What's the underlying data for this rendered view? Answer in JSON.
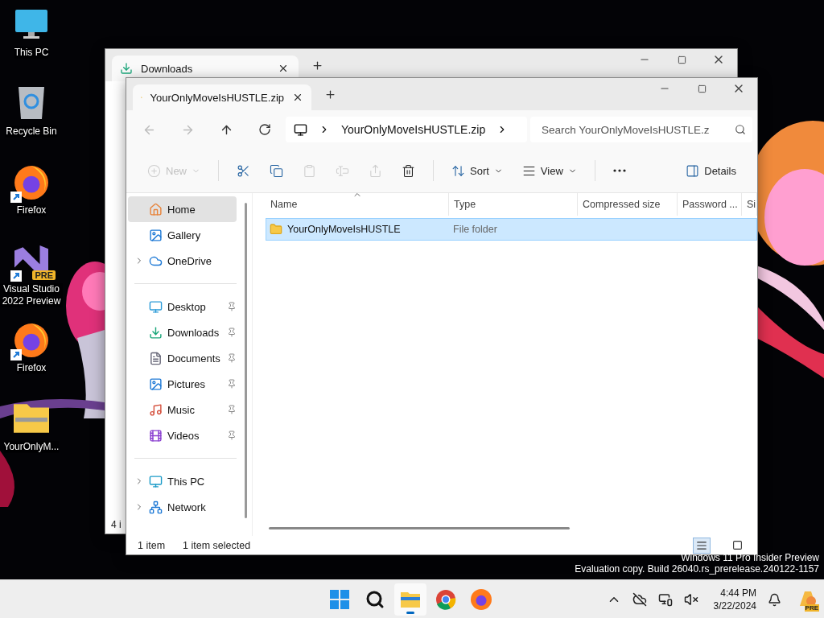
{
  "desktop_icons": [
    {
      "label": "This PC",
      "kind": "pc",
      "shortcut": false
    },
    {
      "label": "Recycle Bin",
      "kind": "bin",
      "shortcut": false
    },
    {
      "label": "Firefox",
      "kind": "firefox",
      "shortcut": true
    },
    {
      "label": "Visual Studio 2022 Preview",
      "kind": "vs",
      "shortcut": true,
      "badge": "PRE"
    },
    {
      "label": "Firefox",
      "kind": "firefox",
      "shortcut": true
    },
    {
      "label": "YourOnlyM...",
      "kind": "zip",
      "shortcut": false
    }
  ],
  "back_window": {
    "tab": "Downloads",
    "status": "4 i"
  },
  "window": {
    "tab": "YourOnlyMoveIsHUSTLE.zip",
    "breadcrumb": [
      "YourOnlyMoveIsHUSTLE.zip"
    ],
    "search": {
      "placeholder": "Search YourOnlyMoveIsHUSTLE.z"
    },
    "toolbar": [
      {
        "kind": "new",
        "label": "New",
        "disabled": true
      },
      {
        "kind": "cut",
        "disabled": false
      },
      {
        "kind": "copy",
        "disabled": false
      },
      {
        "kind": "paste",
        "disabled": true
      },
      {
        "kind": "rename",
        "disabled": true
      },
      {
        "kind": "share",
        "disabled": true
      },
      {
        "kind": "delete",
        "disabled": false
      },
      {
        "kind": "sort",
        "label": "Sort",
        "disabled": false
      },
      {
        "kind": "view",
        "label": "View",
        "disabled": false
      },
      {
        "kind": "more",
        "disabled": false
      },
      {
        "kind": "details",
        "label": "Details",
        "disabled": false
      }
    ],
    "sidebar": [
      [
        {
          "label": "Home",
          "kind": "home",
          "selected": true,
          "expandable": false,
          "pinned": false
        },
        {
          "label": "Gallery",
          "kind": "gallery",
          "selected": false,
          "expandable": false,
          "pinned": false
        },
        {
          "label": "OneDrive",
          "kind": "cloud",
          "selected": false,
          "expandable": true,
          "pinned": false
        }
      ],
      [
        {
          "label": "Desktop",
          "kind": "desktop",
          "selected": false,
          "expandable": false,
          "pinned": true
        },
        {
          "label": "Downloads",
          "kind": "download",
          "selected": false,
          "expandable": false,
          "pinned": true
        },
        {
          "label": "Documents",
          "kind": "document",
          "selected": false,
          "expandable": false,
          "pinned": true
        },
        {
          "label": "Pictures",
          "kind": "pictures",
          "selected": false,
          "expandable": false,
          "pinned": true
        },
        {
          "label": "Music",
          "kind": "music",
          "selected": false,
          "expandable": false,
          "pinned": true
        },
        {
          "label": "Videos",
          "kind": "video",
          "selected": false,
          "expandable": false,
          "pinned": true
        }
      ],
      [
        {
          "label": "This PC",
          "kind": "pc",
          "selected": false,
          "expandable": true,
          "pinned": false
        },
        {
          "label": "Network",
          "kind": "network",
          "selected": false,
          "expandable": true,
          "pinned": false
        }
      ]
    ],
    "columns": [
      {
        "label": "Name",
        "sorted": true
      },
      {
        "label": "Type",
        "sorted": false
      },
      {
        "label": "Compressed size",
        "sorted": false
      },
      {
        "label": "Password ...",
        "sorted": false
      },
      {
        "label": "Si",
        "sorted": false
      }
    ],
    "rows": [
      {
        "name": "YourOnlyMoveIsHUSTLE",
        "type": "File folder",
        "selected": true
      }
    ],
    "status": {
      "count": "1 item",
      "selection": "1 item selected"
    },
    "views": [
      {
        "kind": "details",
        "selected": true
      },
      {
        "kind": "tiles",
        "selected": false
      }
    ]
  },
  "watermark": [
    "Windows 11 Pro Insider Preview",
    "Evaluation copy. Build 26040.rs_prerelease.240122-1157"
  ],
  "taskbar": {
    "apps": [
      {
        "kind": "start",
        "active": false
      },
      {
        "kind": "search",
        "active": false
      },
      {
        "kind": "explorer",
        "active": true
      },
      {
        "kind": "chrome",
        "active": false
      },
      {
        "kind": "firefox",
        "active": false
      }
    ],
    "tray": [
      {
        "kind": "chevron"
      },
      {
        "kind": "cloud-off"
      },
      {
        "kind": "network"
      },
      {
        "kind": "volume-muted"
      }
    ],
    "time": "4:44 PM",
    "date": "3/22/2024",
    "copilot_badge": "PRE"
  }
}
